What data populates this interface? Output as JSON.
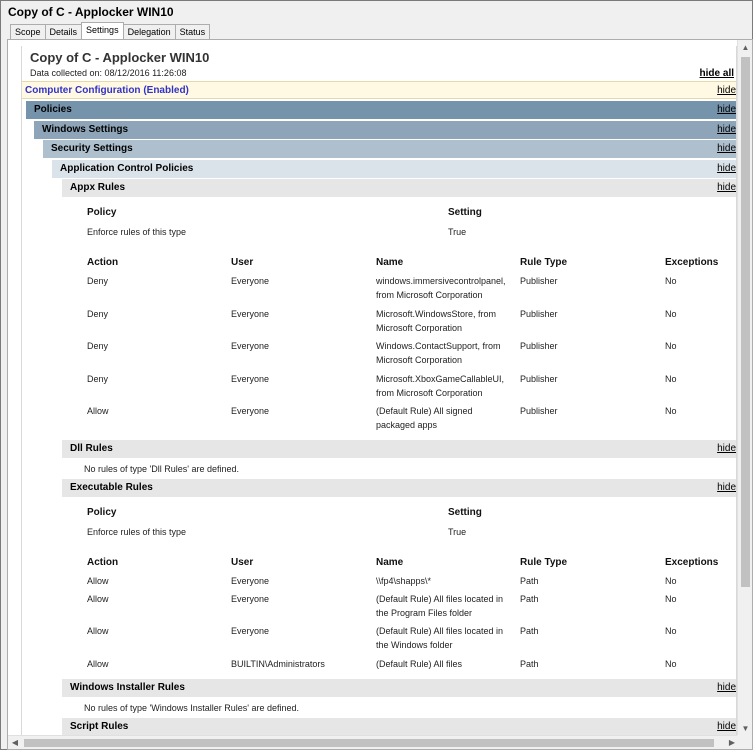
{
  "window": {
    "title": "Copy of C - Applocker WIN10"
  },
  "tabs": [
    "Scope",
    "Details",
    "Settings",
    "Delegation",
    "Status"
  ],
  "report": {
    "title": "Copy of C - Applocker WIN10",
    "collected": "Data collected on: 08/12/2016 11:26:08",
    "hide_all": "hide all",
    "hide": "hide"
  },
  "sections": {
    "computer_config": "Computer Configuration (Enabled)",
    "policies": "Policies",
    "windows_settings": "Windows Settings",
    "security_settings": "Security Settings",
    "app_control": "Application Control Policies",
    "appx_rules": "Appx Rules",
    "dll_rules": "Dll Rules",
    "exe_rules": "Executable Rules",
    "installer_rules": "Windows Installer Rules",
    "script_rules": "Script Rules"
  },
  "policy_headers": {
    "policy": "Policy",
    "setting": "Setting"
  },
  "rule_headers": {
    "action": "Action",
    "user": "User",
    "name": "Name",
    "rule_type": "Rule Type",
    "exceptions": "Exceptions"
  },
  "appx": {
    "enforce": {
      "policy": "Enforce rules of this type",
      "setting": "True"
    },
    "rules": [
      {
        "action": "Deny",
        "user": "Everyone",
        "name1": "windows.immersivecontrolpanel,",
        "name2": "from Microsoft Corporation",
        "type": "Publisher",
        "exceptions": "No"
      },
      {
        "action": "Deny",
        "user": "Everyone",
        "name1": "Microsoft.WindowsStore, from",
        "name2": "Microsoft Corporation",
        "type": "Publisher",
        "exceptions": "No"
      },
      {
        "action": "Deny",
        "user": "Everyone",
        "name1": "Windows.ContactSupport, from",
        "name2": "Microsoft Corporation",
        "type": "Publisher",
        "exceptions": "No"
      },
      {
        "action": "Deny",
        "user": "Everyone",
        "name1": "Microsoft.XboxGameCallableUI,",
        "name2": "from Microsoft Corporation",
        "type": "Publisher",
        "exceptions": "No"
      },
      {
        "action": "Allow",
        "user": "Everyone",
        "name1": "(Default Rule) All signed",
        "name2": "packaged apps",
        "type": "Publisher",
        "exceptions": "No"
      }
    ]
  },
  "dll": {
    "none": "No rules of type 'Dll Rules' are defined."
  },
  "exe": {
    "enforce": {
      "policy": "Enforce rules of this type",
      "setting": "True"
    },
    "rules": [
      {
        "action": "Allow",
        "user": "Everyone",
        "name1": "\\\\fp4\\shapps\\*",
        "name2": "",
        "type": "Path",
        "exceptions": "No"
      },
      {
        "action": "Allow",
        "user": "Everyone",
        "name1": "(Default Rule) All files located in",
        "name2": "the Program Files folder",
        "type": "Path",
        "exceptions": "No"
      },
      {
        "action": "Allow",
        "user": "Everyone",
        "name1": "(Default Rule) All files located in",
        "name2": "the Windows folder",
        "type": "Path",
        "exceptions": "No"
      },
      {
        "action": "Allow",
        "user": "BUILTIN\\Administrators",
        "name1": "(Default Rule) All files",
        "name2": "",
        "type": "Path",
        "exceptions": "No"
      }
    ]
  },
  "installer": {
    "none": "No rules of type 'Windows Installer Rules' are defined."
  }
}
